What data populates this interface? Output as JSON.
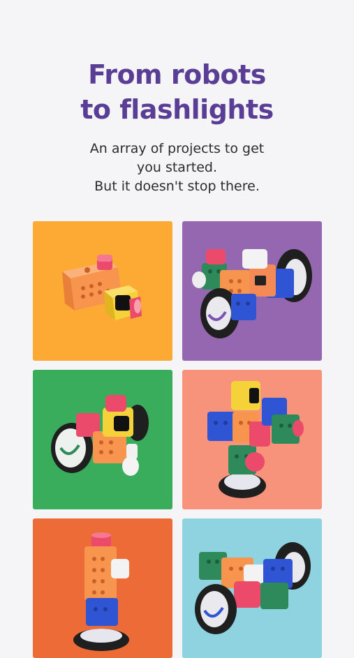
{
  "header": {
    "title_line1": "From robots",
    "title_line2": "to flashlights",
    "subtitle_line1": "An array of projects to get",
    "subtitle_line2": "you started.",
    "subtitle_line3": "But it doesn't stop there."
  },
  "projects": [
    {
      "image": "flashlight-robot-image",
      "background": "#fdaa35"
    },
    {
      "image": "wheeled-robot-image",
      "background": "#9567b0"
    },
    {
      "image": "car-robot-image",
      "background": "#39ad5c"
    },
    {
      "image": "tower-robot-image",
      "background": "#f6937a"
    },
    {
      "image": "lamp-robot-image",
      "background": "#ec6b36"
    },
    {
      "image": "rover-robot-image",
      "background": "#8fd3e1"
    }
  ],
  "colors": {
    "title": "#5a3e96",
    "page_background": "#f5f5f7",
    "cube_orange": "#f7944d",
    "cube_pink": "#ec4a6a",
    "cube_yellow": "#f6d23a",
    "cube_blue": "#2f55d4",
    "cube_green": "#2e8a5a",
    "wheel": "#222222"
  }
}
